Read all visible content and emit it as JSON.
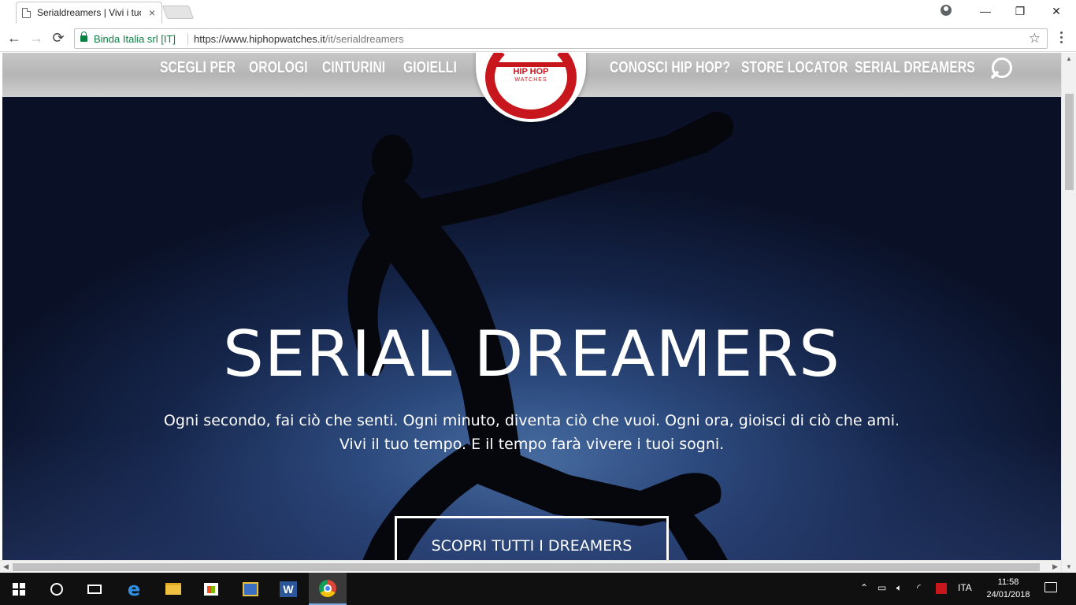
{
  "browser": {
    "tab_title": "Serialdreamers | Vivi i tuo",
    "tab_close": "×",
    "security_label": "Binda Italia srl [IT]",
    "url_host": "https://www.hiphopwatches.it",
    "url_path": "/it/serialdreamers",
    "window_minimize": "—",
    "window_restore": "❐",
    "window_close": "✕",
    "back": "←",
    "forward": "→",
    "reload": "⟳",
    "bookmark_star": "☆"
  },
  "site": {
    "nav_left": [
      "SCEGLI PER",
      "OROLOGI",
      "CINTURINI",
      "GIOIELLI"
    ],
    "nav_right": [
      "CONOSCI HIP HOP?",
      "STORE LOCATOR",
      "SERIAL DREAMERS"
    ],
    "logo_text": "HIP HOP",
    "logo_sub": "WATCHES",
    "brand_red": "#c8161d"
  },
  "hero": {
    "title": "SERIAL DREAMERS",
    "subtitle_line1": "Ogni secondo, fai ciò che senti. Ogni minuto, diventa ciò che vuoi. Ogni ora, gioisci di ciò che ami.",
    "subtitle_line2": "Vivi il tuo tempo. E il tempo farà vivere i tuoi sogni.",
    "button_label": "SCOPRI TUTTI I DREAMERS"
  },
  "taskbar": {
    "language": "ITA",
    "time": "11:58",
    "date": "24/01/2018",
    "word_letter": "W",
    "edge_letter": "e"
  }
}
